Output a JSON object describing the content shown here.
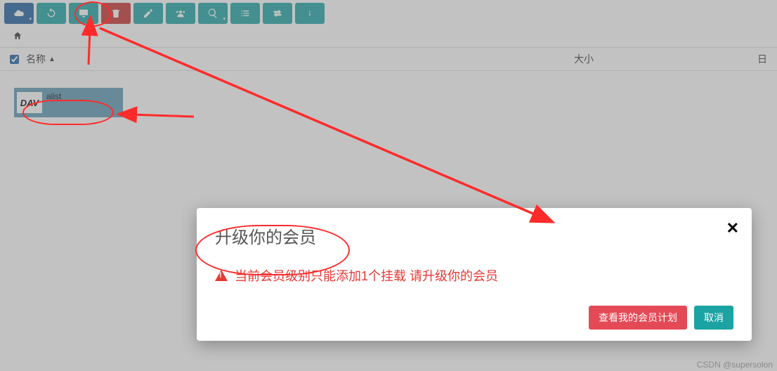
{
  "toolbar": {
    "items": [
      {
        "name": "cloud-button",
        "color": "blue",
        "icon": "cloud",
        "dropdown": true
      },
      {
        "name": "refresh-button",
        "color": "teal",
        "icon": "refresh",
        "dropdown": false
      },
      {
        "name": "display-button",
        "color": "teal",
        "icon": "monitor",
        "dropdown": false
      },
      {
        "name": "delete-button",
        "color": "red",
        "icon": "trash",
        "dropdown": false
      },
      {
        "name": "edit-button",
        "color": "teal",
        "icon": "edit",
        "dropdown": false
      },
      {
        "name": "share-button",
        "color": "teal",
        "icon": "users",
        "dropdown": false
      },
      {
        "name": "zoom-button",
        "color": "teal",
        "icon": "zoom",
        "dropdown": true
      },
      {
        "name": "list-button",
        "color": "teal",
        "icon": "list",
        "dropdown": false
      },
      {
        "name": "transfer-button",
        "color": "teal",
        "icon": "transfer",
        "dropdown": false
      },
      {
        "name": "info-button",
        "color": "teal",
        "icon": "info",
        "dropdown": false
      }
    ]
  },
  "breadcrumb": {
    "home_icon": "home"
  },
  "columns": {
    "name": "名称",
    "sort_indicator": "▲",
    "size": "大小",
    "date": "日"
  },
  "checkbox_all": true,
  "files": [
    {
      "icon_text": "DAV",
      "label": "alist"
    }
  ],
  "modal": {
    "title": "升级你的会员",
    "message": "当前会员级别只能添加1个挂载 请升级你的会员",
    "primary_button": "查看我的会员计划",
    "cancel_button": "取消"
  },
  "watermark": "CSDN @supersolon"
}
